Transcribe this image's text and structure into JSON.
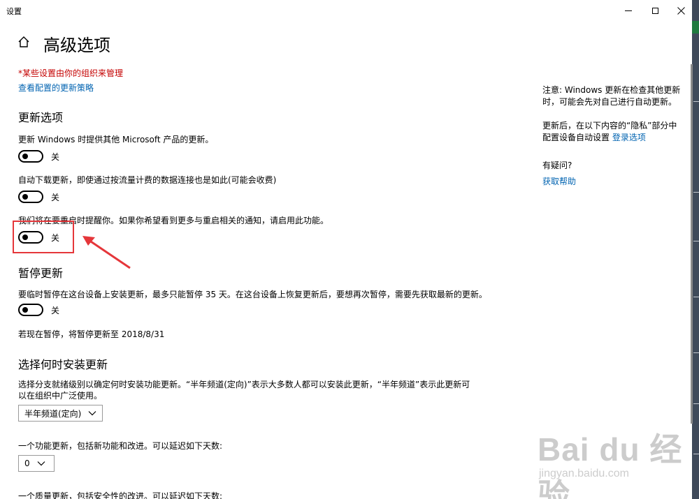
{
  "window": {
    "title": "设置"
  },
  "page": {
    "title": "高级选项"
  },
  "notice": {
    "managed": "*某些设置由你的组织来管理",
    "policy_link": "查看配置的更新策略"
  },
  "update_options": {
    "heading": "更新选项",
    "items": [
      {
        "description": "更新 Windows 时提供其他 Microsoft 产品的更新。",
        "state": "关"
      },
      {
        "description": "自动下载更新，即使通过按流量计费的数据连接也是如此(可能会收费)",
        "state": "关"
      },
      {
        "description": "我们将在要重启时提醒你。如果你希望看到更多与重启相关的通知，请启用此功能。",
        "state": "关"
      }
    ]
  },
  "pause": {
    "heading": "暂停更新",
    "description": "要临时暂停在这台设备上安装更新，最多只能暂停 35 天。在这台设备上恢复更新后，要想再次暂停，需要先获取最新的更新。",
    "state": "关",
    "note": "若现在暂停，将暂停更新至 2018/8/31"
  },
  "install_timing": {
    "heading": "选择何时安装更新",
    "description_line1": "选择分支就绪级别以确定何时安装功能更新。“半年频道(定向)”表示大多数人都可以安装此更新，“半年频道”表示此更新可",
    "description_line2": "以在组织中广泛使用。",
    "channel_value": "半年频道(定向)",
    "feature_defer_label": "一个功能更新，包括新功能和改进。可以延迟如下天数:",
    "feature_defer_value": "0",
    "quality_defer_label": "一个质量更新，包括安全性的改进。可以延迟如下天数:"
  },
  "side_panel": {
    "note_line1": "注意: Windows 更新在检查其他更新",
    "note_line2": "时，可能会先对自己进行自动更新。",
    "privacy_line1": "更新后，在以下内容的“隐私”部分中",
    "privacy_line2": "配置设备自动设置 ",
    "privacy_link": "登录选项",
    "question": "有疑问?",
    "help_link": "获取帮助"
  },
  "watermark": {
    "main": "Bai du 经验",
    "sub": "jingyan.baidu.com"
  },
  "colors": {
    "accent_link": "#0063b1",
    "warning_red": "#c40000",
    "annotation_red": "#e5363a"
  }
}
